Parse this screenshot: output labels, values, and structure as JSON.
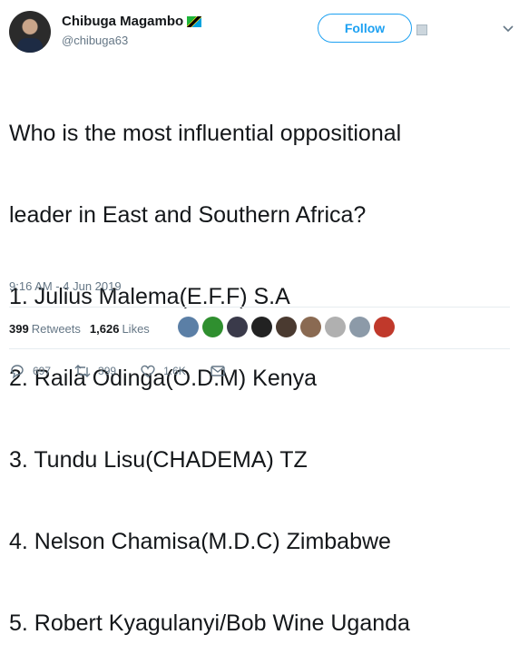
{
  "author": {
    "display_name": "Chibuga Magambo",
    "handle": "@chibuga63",
    "avatar_icon": "profile-photo-icon",
    "flag_icon": "tanzania-flag-icon"
  },
  "header": {
    "follow_label": "Follow",
    "more_icon": "chevron-down-icon"
  },
  "tweet": {
    "lines": [
      "Who is the most influential oppositional",
      "leader in East and Southern Africa?",
      "1. Julius Malema(E.F.F) S.A",
      "2. Raila Odinga(O.D.M) Kenya",
      "3. Tundu Lisu(CHADEMA) TZ",
      "4. Nelson Chamisa(M.D.C) Zimbabwe",
      "5. Robert Kyagulanyi/Bob Wine Uganda"
    ],
    "timestamp": "9:16 AM - 4 Jun 2019"
  },
  "stats": {
    "retweets_count": "399",
    "retweets_label": "Retweets",
    "likes_count": "1,626",
    "likes_label": "Likes"
  },
  "likers": [
    {
      "color": "#5b7fa6"
    },
    {
      "color": "#2f8f2f"
    },
    {
      "color": "#3a3a4a"
    },
    {
      "color": "#222222"
    },
    {
      "color": "#4a3a30"
    },
    {
      "color": "#8a6a52"
    },
    {
      "color": "#b0b0b0"
    },
    {
      "color": "#8c9aa8"
    },
    {
      "color": "#c0392b"
    }
  ],
  "actions": {
    "replies": "697",
    "retweets": "399",
    "likes": "1.6K"
  }
}
